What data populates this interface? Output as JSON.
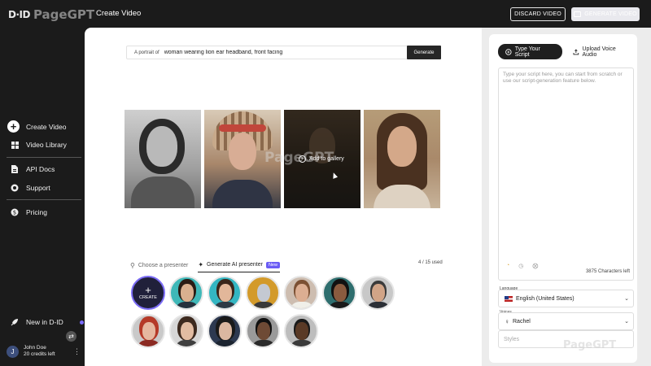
{
  "header": {
    "logo_mark": "D·ID",
    "logo_text": "PageGPT",
    "page_title": "Create Video",
    "discard_label": "DISCARD VIDEO",
    "generate_video_label": "GENERATE VIDEO"
  },
  "sidebar": {
    "items": [
      {
        "label": "Create Video",
        "icon": "plus-circle-icon"
      },
      {
        "label": "Video Library",
        "icon": "grid-icon"
      },
      {
        "label": "API Docs",
        "icon": "document-icon"
      },
      {
        "label": "Support",
        "icon": "lifebuoy-icon"
      },
      {
        "label": "Pricing",
        "icon": "dollar-icon"
      },
      {
        "label": "New in D-ID",
        "icon": "rocket-icon"
      }
    ],
    "user": {
      "initial": "J",
      "name": "John Doe",
      "credits": "20 credits left"
    }
  },
  "prompt": {
    "prefix": "A portrait of",
    "value": "woman wearing lion ear headband, front facing",
    "generate_label": "Generate"
  },
  "gallery": {
    "hover_label": "Add to gallery",
    "watermark": "PageGPT"
  },
  "presenter_tabs": {
    "choose_label": "Choose a presenter",
    "generate_label": "Generate AI presenter",
    "new_badge": "New",
    "used_count": "4 / 15 used",
    "create_label": "CREATE"
  },
  "right_panel": {
    "tab_type_script": "Type Your Script",
    "tab_upload_audio": "Upload Voice Audio",
    "script_placeholder": "Type your script here, you can start from scratch or use our script-generation feature below.",
    "chars_left": "3875 Characters left",
    "language_label": "Language",
    "language_value": "English (United States)",
    "voices_label": "Voices",
    "voice_value": "Rachel",
    "styles_placeholder": "Styles",
    "watermark": "PageGPT"
  },
  "colors": {
    "sidebar_bg": "#1b1b1b",
    "accent_purple": "#6a5cf5",
    "main_bg": "#ffffff",
    "right_panel_bg": "#ececec"
  }
}
